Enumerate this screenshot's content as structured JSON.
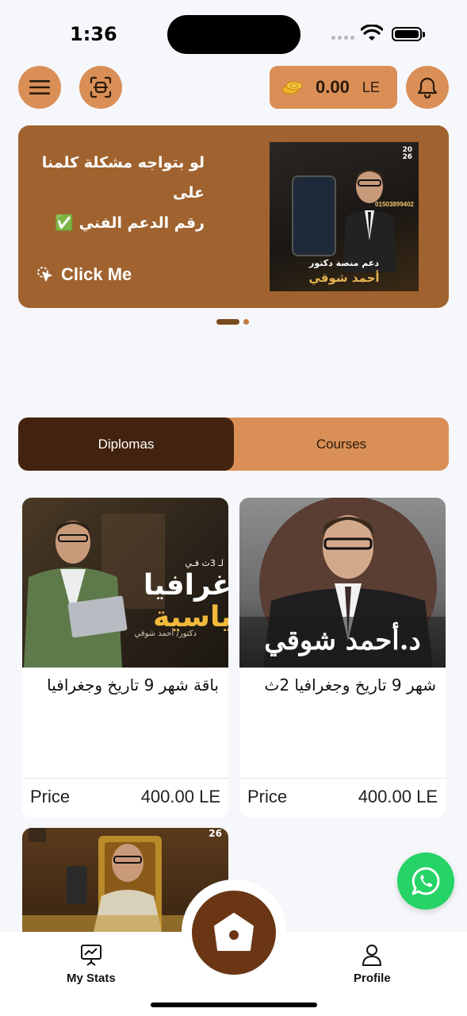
{
  "status_bar": {
    "time": "1:36"
  },
  "header": {
    "wallet": {
      "amount": "0.00",
      "currency": "LE"
    }
  },
  "banner": {
    "line1": "لو بتواجه مشكلة كلمنا على",
    "line2": "رقم الدعم الفني ✅",
    "cta": "Click Me",
    "image": {
      "year_top": "20",
      "year_bottom": "26",
      "phone": "01503899402",
      "caption1": "دعم منصة دكتور",
      "caption2": "أحمد شوقي"
    }
  },
  "pager": {
    "count": 2,
    "active_index": 0
  },
  "tabs": [
    {
      "label": "Diplomas",
      "active": true
    },
    {
      "label": "Courses",
      "active": false
    }
  ],
  "cards": [
    {
      "title": "باقة شهر 9 تاريخ وجغرافيا",
      "price_label": "Price",
      "price": "400.00 LE",
      "overlay_main": "غرافيا",
      "overlay_sub": "ياسية",
      "overlay_small": "لـ 3ث فـي",
      "overlay_author": "دكتور/ أحمد شوقي"
    },
    {
      "title": "شهر 9 تاريخ وجغرافيا 2ث",
      "price_label": "Price",
      "price": "400.00 LE",
      "overlay_name": "د.أحمد شوقي"
    },
    {
      "year": "26"
    }
  ],
  "bottom_nav": {
    "stats_label": "My Stats",
    "profile_label": "Profile"
  },
  "colors": {
    "accent": "#d98f56",
    "dark_brown": "#42230f",
    "banner": "#a0632f",
    "whatsapp": "#25d366"
  }
}
